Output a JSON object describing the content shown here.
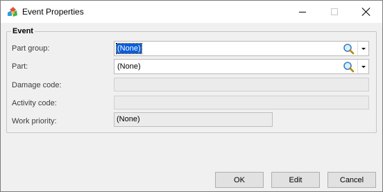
{
  "window": {
    "title": "Event Properties"
  },
  "group": {
    "title": "Event"
  },
  "fields": {
    "part_group": {
      "label": "Part group:",
      "value": "(None)"
    },
    "part": {
      "label": "Part:",
      "value": "(None)"
    },
    "damage_code": {
      "label": "Damage code:",
      "value": ""
    },
    "activity_code": {
      "label": "Activity code:",
      "value": ""
    },
    "work_priority": {
      "label": "Work priority:",
      "value": "(None)"
    }
  },
  "buttons": {
    "ok": "OK",
    "edit": "Edit",
    "cancel": "Cancel"
  },
  "colors": {
    "selection": "#0b5ed7",
    "titlebar": "#ffffff",
    "background": "#f0f0f0"
  }
}
